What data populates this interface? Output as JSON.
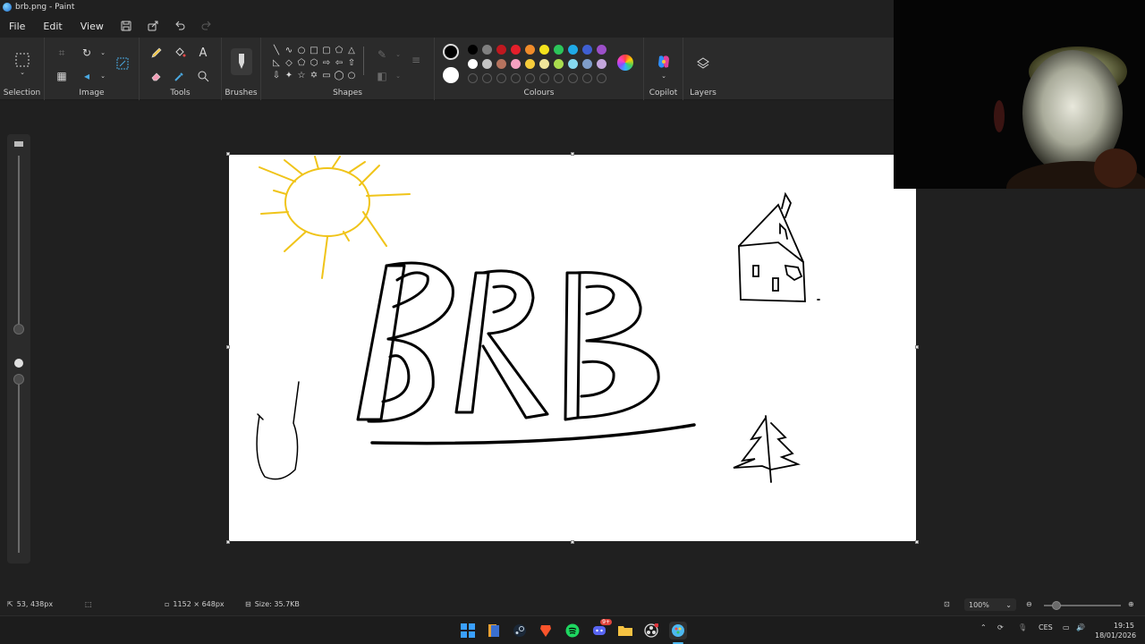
{
  "window": {
    "title": "brb.png - Paint"
  },
  "menu": {
    "file": "File",
    "edit": "Edit",
    "view": "View"
  },
  "ribbon": {
    "groups": {
      "selection": "Selection",
      "image": "Image",
      "tools": "Tools",
      "brushes": "Brushes",
      "shapes": "Shapes",
      "colours": "Colours",
      "copilot": "Copilot",
      "layers": "Layers"
    },
    "palette_top": [
      "#000000",
      "#7f7f7f",
      "#c0181f",
      "#e51f2b",
      "#f08c2a",
      "#f4e21c",
      "#2cc55a",
      "#1fa9e6",
      "#3f5fd2",
      "#9c4fc9"
    ],
    "palette_mid": [
      "#ffffff",
      "#c3c3c3",
      "#b5735e",
      "#f6a2c1",
      "#f6cc3b",
      "#efe49a",
      "#a9dc4e",
      "#86d8ee",
      "#7f9dc9",
      "#c3a6dc"
    ],
    "primary_color": "#000000",
    "secondary_color": "#ffffff"
  },
  "canvas": {
    "text": "BRB"
  },
  "status": {
    "cursor_pos": "53, 438px",
    "canvas_size": "1152 × 648px",
    "file_size": "Size: 35.7KB",
    "zoom": "100%"
  },
  "taskbar": {
    "language": "CES",
    "time": "19:15",
    "date": "18/01/2026",
    "discord_badge": "9+"
  }
}
